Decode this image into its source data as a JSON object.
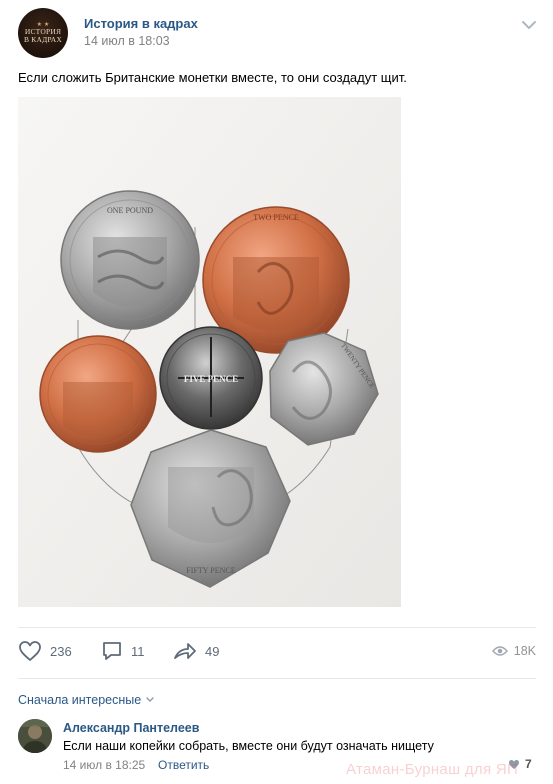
{
  "post": {
    "group_name": "История в кадрах",
    "avatar_text_line1": "ИСТОРИЯ",
    "avatar_text_line2": "В КАДРАХ",
    "date": "14 июл в 18:03",
    "text": "Если сложить Британские монетки вместе, то они создадут щит.",
    "photo": {
      "coin_labels": [
        "ONE POUND",
        "TWO PENCE",
        "FIVE PENCE",
        "TWENTY PENCE",
        "FIFTY PENCE"
      ]
    }
  },
  "actions": {
    "likes": "236",
    "comments": "11",
    "shares": "49",
    "views": "18K"
  },
  "comments": {
    "sort_label": "Сначала интересные",
    "items": [
      {
        "author": "Александр Пантелеев",
        "text": "Если наши копейки собрать, вместе они будут означать нищету",
        "date": "14 июл в 18:25",
        "reply_label": "Ответить",
        "likes": "7"
      }
    ]
  },
  "watermark": "Атаман-Бурнаш для ЯП",
  "colors": {
    "link": "#2a5885",
    "muted": "#828282",
    "icon": "#5f6b7a",
    "divider": "#e7e8ec"
  },
  "icons": [
    "chevron-down-icon",
    "heart-icon",
    "comment-icon",
    "share-icon",
    "eye-icon"
  ]
}
